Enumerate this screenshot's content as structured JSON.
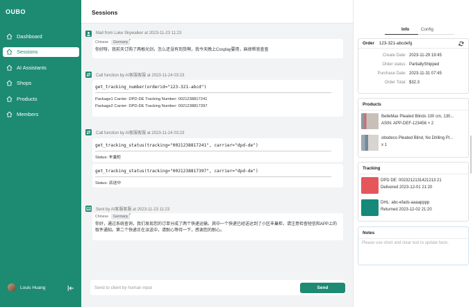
{
  "app": {
    "brand": "OUBO"
  },
  "sidebar": {
    "items": [
      {
        "label": "Dashboard",
        "icon": "home-icon"
      },
      {
        "label": "Sessions",
        "icon": "home-icon",
        "active": true
      },
      {
        "label": "AI Assistants",
        "icon": "home-icon"
      },
      {
        "label": "Shops",
        "icon": "home-icon"
      },
      {
        "label": "Products",
        "icon": "home-icon"
      },
      {
        "label": "Members",
        "icon": "home-icon"
      }
    ],
    "user": {
      "name": "Louis Huang"
    }
  },
  "main": {
    "title": "Sessions",
    "messages": [
      {
        "title": "Mail from Luke Skywalker at 2023-11-23 11:23",
        "tabs": [
          "Chinese",
          "Germany"
        ],
        "text": "你好呀，我前天订购了两根光剑，怎么还没有到货啊，我今天晚上Cosplay要用，麻烦帮我查查"
      },
      {
        "title": "Call function by AI客服客服 at 2023-11-24 03:23",
        "call": "get_tracking_number(orderid=\"123-321-abcd\")",
        "results": [
          "Package1 Carrier: DPD-DE Tracking Number: 0021238817241",
          "Package2 Carrier: DPD-DE Tracking Number: 0021238817397"
        ]
      },
      {
        "title": "Call function by AI客服客服 at 2023-11-24 03:23",
        "calls": [
          {
            "call": "get_tracking_status(tracking=\"0021238817241\", carrier=\"dpd-de\")",
            "status": "Status: 丰巢柜"
          },
          {
            "call": "get_tracking_status(tracking=\"0021238817397\", carrier=\"dpd-de\")",
            "status": "Status: 派送中"
          }
        ]
      },
      {
        "title": "Sent by AI客服客服 at 2023-11-23 11:23",
        "tabs": [
          "Chinese",
          "Germany"
        ],
        "text": "你好，通过系统查询，我们发现您的订单分成了两个快递运输。其中一个快递已经送达到了小区丰巢柜，请注意检查短信和APP上的取件通知。第二个快递正在派送中，请耐心等待一下，感谢您的耐心。"
      }
    ],
    "input": {
      "placeholder": "Send to client by human input"
    },
    "send_label": "Send"
  },
  "right": {
    "tabs": [
      "Info",
      "Config"
    ],
    "order": {
      "label": "Order",
      "id": "123-321-abcdefg",
      "fields": [
        {
          "k": "Create Date:",
          "v": "2023-11-29 19:45"
        },
        {
          "k": "Order status:",
          "v": "PartiallyShipped"
        },
        {
          "k": "Purchase Date:",
          "v": "2023-11-31 07:45"
        },
        {
          "k": "Order Total:",
          "v": "$32.3"
        }
      ]
    },
    "products": {
      "title": "Products",
      "items": [
        {
          "line1": "BelleMax Pleated Blinds 100 cm, 130...",
          "line2": "ASIN: APP-DEF-123456 × 2"
        },
        {
          "line1": "obodeco Pleated Blind, No Drilling Pl...",
          "line2": "x 1"
        }
      ]
    },
    "tracking": {
      "title": "Tracking",
      "items": [
        {
          "color": "#e5565b",
          "line1": "DPD DE: 0023212131421213 21",
          "line2": "Delivered 2023-12-01 21:20"
        },
        {
          "color": "#158a7b",
          "line1": "DHL: abc-efads-aaaapppp",
          "line2": "Returned 2023-12-02 21:20"
        }
      ]
    },
    "notes": {
      "title": "Notes",
      "placeholder": "Please use short and clear text to update facts."
    }
  },
  "colors": {
    "accent": "#1d8a72",
    "danger": "#e5565b",
    "teal": "#158a7b"
  }
}
